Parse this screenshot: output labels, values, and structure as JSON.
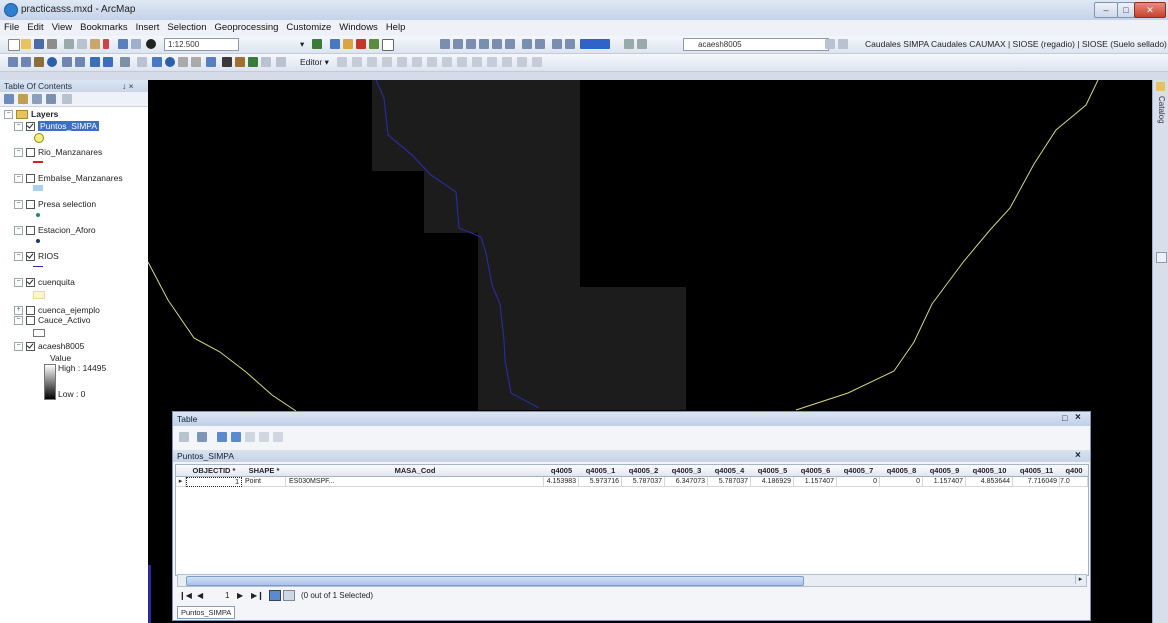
{
  "window": {
    "title": "practicasss.mxd - ArcMap"
  },
  "menu": [
    "File",
    "Edit",
    "View",
    "Bookmarks",
    "Insert",
    "Selection",
    "Geoprocessing",
    "Customize",
    "Windows",
    "Help"
  ],
  "toolbar": {
    "scale": "1:12.500",
    "layer_combo": "acaesh8005",
    "editor_label": "Editor ▾",
    "quick_links": "Caudales SIMPA  Caudales CAUMAX |  SIOSE (regadio) |  SIOSE (Suelo sellado) |"
  },
  "toc": {
    "title": "Table Of Contents",
    "pin": "↓ ×",
    "root": "Layers",
    "layers": [
      {
        "label": "Puntos_SIMPA",
        "checked": true,
        "selected": true,
        "symbol": "circle-yellow"
      },
      {
        "label": "Rio_Manzanares",
        "checked": false,
        "symbol": "line-red"
      },
      {
        "label": "Embalse_Manzanares",
        "checked": false,
        "symbol": "fill-lightblue"
      },
      {
        "label": "Presa selection",
        "checked": false,
        "symbol": "dot-teal"
      },
      {
        "label": "Estacion_Aforo",
        "checked": false,
        "symbol": "dot-navy"
      },
      {
        "label": "RIOS",
        "checked": true,
        "symbol": "line-navy"
      },
      {
        "label": "cuenquita",
        "checked": true,
        "symbol": "fill-lightyellow"
      },
      {
        "label": "cuenca_ejemplo",
        "checked": false,
        "symbol": "none"
      },
      {
        "label": "Cauce_Activo",
        "checked": false,
        "symbol": "fill-outline"
      },
      {
        "label": "acaesh8005",
        "checked": true,
        "symbol": "ramp"
      }
    ],
    "raster_value_label": "Value",
    "raster_high": "High : 14495",
    "raster_low": "Low : 0"
  },
  "right_panel": {
    "catalog_label": "Catalog"
  },
  "table_window": {
    "title": "Table",
    "close": "×",
    "layer_name": "Puntos_SIMPA",
    "columns": [
      "",
      "OBJECTID *",
      "SHAPE *",
      "MASA_Cod",
      "q4005",
      "q4005_1",
      "q4005_2",
      "q4005_3",
      "q4005_4",
      "q4005_5",
      "q4005_6",
      "q4005_7",
      "q4005_8",
      "q4005_9",
      "q4005_10",
      "q4005_11",
      "q400"
    ],
    "rows": [
      [
        "▸",
        "1",
        "Point",
        "ES030MSPF...",
        "4.153983",
        "5.973716",
        "5.787037",
        "6.347073",
        "5.787037",
        "4.186929",
        "1.157407",
        "0",
        "0",
        "1.157407",
        "4.853644",
        "7.716049",
        "7.0"
      ]
    ],
    "nav_first": "❙◀",
    "nav_prev": "◀",
    "record": "1",
    "nav_next": "▶",
    "nav_last": "▶❙",
    "selection_status": "(0 out of 1 Selected)",
    "tab_label": "Puntos_SIMPA"
  },
  "colors": {
    "map_bg": "#000000",
    "raster_patch": "#1c1c1c",
    "yellow_line": "#d8d87a",
    "blue_line": "#2a2a9a",
    "selection": "#3a6fc6"
  }
}
